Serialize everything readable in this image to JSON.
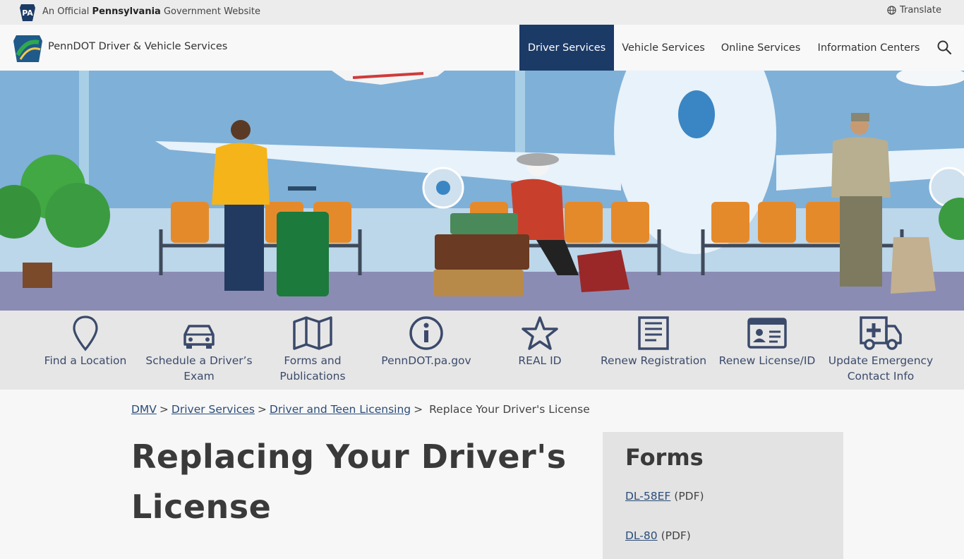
{
  "gov_bar": {
    "badge_text": "PA",
    "prefix": "An Official ",
    "state": "Pennsylvania",
    "suffix": " Government Website",
    "translate_label": "Translate"
  },
  "header": {
    "site_name": "PennDOT Driver & Vehicle Services",
    "nav": [
      {
        "label": "Driver Services",
        "active": true
      },
      {
        "label": "Vehicle Services",
        "active": false
      },
      {
        "label": "Online Services",
        "active": false
      },
      {
        "label": "Information Centers",
        "active": false
      }
    ]
  },
  "quick_links": [
    {
      "label": "Find a Location",
      "icon": "map-pin-icon"
    },
    {
      "label": "Schedule a Driver’s Exam",
      "icon": "car-icon"
    },
    {
      "label": "Forms and Publications",
      "icon": "map-icon"
    },
    {
      "label": "PennDOT.pa.gov",
      "icon": "info-icon"
    },
    {
      "label": "REAL ID",
      "icon": "star-icon"
    },
    {
      "label": "Renew Registration",
      "icon": "document-icon"
    },
    {
      "label": "Renew License/ID",
      "icon": "id-card-icon"
    },
    {
      "label": "Update Emergency Contact Info",
      "icon": "ambulance-icon"
    }
  ],
  "breadcrumb": {
    "items": [
      "DMV",
      "Driver Services",
      "Driver and Teen Licensing"
    ],
    "current": "Replace Your Driver's License"
  },
  "main": {
    "title": "Replacing Your Driver's License"
  },
  "sidebar": {
    "title": "Forms",
    "forms": [
      {
        "name": "DL-58EF",
        "type": "(PDF)"
      },
      {
        "name": "DL-80",
        "type": "(PDF)"
      }
    ]
  },
  "colors": {
    "nav_active": "#1b3a66",
    "link": "#2b4d7a",
    "icon": "#3b4a6b"
  }
}
